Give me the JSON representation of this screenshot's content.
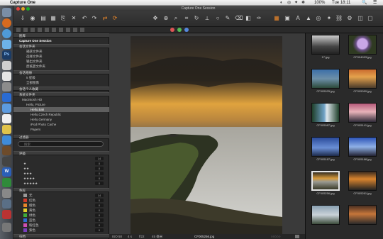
{
  "menubar": {
    "app": "Capture One",
    "right_items": [
      "◐",
      "◎",
      "✦",
      "❅",
      "100%",
      "Tue 18:11",
      "🔍",
      "☰"
    ]
  },
  "window": {
    "title": "Capture One Session"
  },
  "colors": {
    "accent": "#e8862a",
    "selection": "#5f5f5f",
    "panel": "#2b2b2b"
  },
  "left_panel": {
    "library_header": "图库",
    "session_title": "Capture One Session",
    "session_folders_header": "会话文件夹",
    "session_folders": [
      {
        "label": "捕获文件夹"
      },
      {
        "label": "选择文件夹"
      },
      {
        "label": "输出文件夹"
      },
      {
        "label": "废纸篓文件夹"
      }
    ],
    "albums_header": "会话相册",
    "albums": [
      {
        "label": "5 星级"
      },
      {
        "label": "全部图像"
      }
    ],
    "favorites_header": "会话个人收藏",
    "system_header": "系统文件夹",
    "system_items": [
      {
        "label": "Macintosh HD"
      },
      {
        "label": "Hello, Picture"
      },
      {
        "label": "Hello,Bali"
      },
      {
        "label": "Hello,Czech Republic"
      },
      {
        "label": "Hello,Germany"
      },
      {
        "label": "iPod Photo Cache"
      },
      {
        "label": "Papers"
      }
    ],
    "filters_header": "过滤器",
    "search_placeholder": "搜索",
    "rating_header": "评级",
    "ratings": [
      {
        "label": "",
        "count": "14"
      },
      {
        "label": "★",
        "count": "0"
      },
      {
        "label": "★★",
        "count": "0"
      },
      {
        "label": "★★★",
        "count": "0"
      },
      {
        "label": "★★★★",
        "count": "0"
      },
      {
        "label": "★★★★★",
        "count": "0"
      }
    ],
    "color_header": "色标",
    "color_tags": [
      {
        "label": "无",
        "count": "14",
        "color": "#999999"
      },
      {
        "label": "红色",
        "count": "0",
        "color": "#d23a2a"
      },
      {
        "label": "橙色",
        "count": "0",
        "color": "#e8862a"
      },
      {
        "label": "黄色",
        "count": "0",
        "color": "#e3cf2c"
      },
      {
        "label": "绿色",
        "count": "0",
        "color": "#3fae3a"
      },
      {
        "label": "蓝色",
        "count": "0",
        "color": "#2f6fd3"
      },
      {
        "label": "粉红色",
        "count": "0",
        "color": "#d04fb2"
      },
      {
        "label": "紫色",
        "count": "0",
        "color": "#7a3fc0"
      }
    ],
    "last_header": "归档"
  },
  "viewer": {
    "iso": "ISO 50",
    "shutter": "4 s",
    "aperture": "f/22",
    "focal": "45 毫米",
    "filename": "CF005256.jpg"
  },
  "browser": {
    "thumbnails": [
      {
        "label": "17.jpg"
      },
      {
        "label": "CF004993.jpg"
      },
      {
        "label": "CF005025.jpg"
      },
      {
        "label": "CF005059.jpg"
      },
      {
        "label": "CF005087.jpg"
      },
      {
        "label": "CF005141.jpg"
      },
      {
        "label": "CF005187.jpg"
      },
      {
        "label": "CF005188.jpg"
      },
      {
        "label": "CF005256.jpg"
      },
      {
        "label": "CF005261.jpg"
      },
      {
        "label": ""
      },
      {
        "label": ""
      }
    ]
  }
}
